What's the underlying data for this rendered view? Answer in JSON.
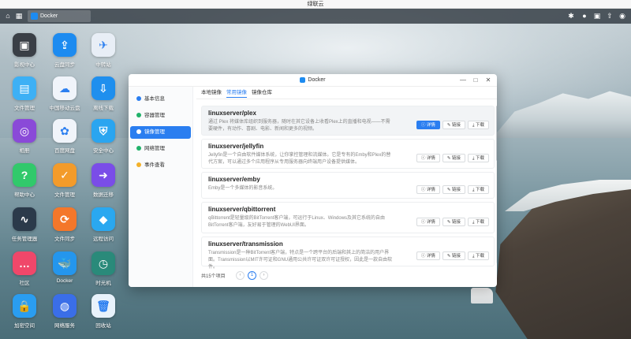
{
  "system": {
    "title": "绿联云"
  },
  "taskbar": {
    "tab_label": "Docker",
    "left_icons": [
      "home-icon",
      "grid-icon"
    ],
    "right_icons": [
      "settings-icon",
      "bell-icon",
      "printer-icon",
      "upload-icon",
      "user-icon"
    ]
  },
  "desktop": {
    "icons": [
      {
        "label": "影视中心",
        "color": "#3a3f46"
      },
      {
        "label": "云盘同步",
        "color": "#1d8bf0"
      },
      {
        "label": "中转站",
        "color": "#e8eef6"
      },
      {
        "label": "文件管理",
        "color": "#3db0f5"
      },
      {
        "label": "中国移动云盘",
        "color": "#f0f4fa"
      },
      {
        "label": "离线下载",
        "color": "#1f8fee"
      },
      {
        "label": "相册",
        "color": "#8a4ad8"
      },
      {
        "label": "百度网盘",
        "color": "#f0f4fa"
      },
      {
        "label": "安全中心",
        "color": "#2aa5f0"
      },
      {
        "label": "帮助中心",
        "color": "#31c96b"
      },
      {
        "label": "文件管理",
        "color": "#f39b2a"
      },
      {
        "label": "数据迁移",
        "color": "#7a4de8"
      },
      {
        "label": "任务管理器",
        "color": "#2b3a4a"
      },
      {
        "label": "文件同步",
        "color": "#f4772a"
      },
      {
        "label": "远程访问",
        "color": "#2aa8f0"
      },
      {
        "label": "社区",
        "color": "#f0476a"
      },
      {
        "label": "Docker",
        "color": "#2496ed"
      },
      {
        "label": "时光机",
        "color": "#2a8a7a"
      },
      {
        "label": "加密空间",
        "color": "#2a9df0"
      },
      {
        "label": "网络服务",
        "color": "#3a6ee8"
      },
      {
        "label": "回收站",
        "color": "#e8f2fb"
      }
    ]
  },
  "window": {
    "title": "Docker",
    "sidebar": [
      {
        "label": "基本信息",
        "dot": "#2a7ef0"
      },
      {
        "label": "容器管理",
        "dot": "#21b26a"
      },
      {
        "label": "镜像管理",
        "dot": "#ffffff"
      },
      {
        "label": "网络管理",
        "dot": "#21b26a"
      },
      {
        "label": "事件查看",
        "dot": "#f3b12a"
      }
    ],
    "tabs": [
      "本地镜像",
      "常用镜像",
      "镜像仓库"
    ],
    "active_tab": 1,
    "images": [
      {
        "name": "linuxserver/plex",
        "desc": "通过 Plex 将媒体库组织到服务器，随时在其它设备上收看Plex上的直播和电视——不需要硬件，有动作、喜剧、电影、新闻和更多的视频。"
      },
      {
        "name": "linuxserver/jellyfin",
        "desc": "Jellyfin是一个自由软件媒体系统，让你掌控管理和流媒体。它是专有的Emby和Plex的替代方案，可以通过多个应用程序从专用服务器向终端用户设备提供媒体。"
      },
      {
        "name": "linuxserver/emby",
        "desc": "Emby是一个多媒体的影音系统。"
      },
      {
        "name": "linuxserver/qbittorrent",
        "desc": "qBittorrent是轻量级的BitTorrent客户端，可运行于Linux、Windows及其它系统的自由BitTorrent客户端，友好易于管理的WebUI界面。"
      },
      {
        "name": "linuxserver/transmission",
        "desc": "Transmission是一种BitTorrent客户端，特点是一个跨平台的后端和其上的简洁的用户界面。Transmission以MIT许可证和GNU通用公共许可证双许可证授权，因此是一款自由软件。"
      }
    ],
    "buttons": {
      "detail": "详情",
      "link": "链接",
      "download": "下载"
    },
    "pager": {
      "total": "共15个项目",
      "prev": "‹",
      "current": "1",
      "next": "›"
    }
  }
}
